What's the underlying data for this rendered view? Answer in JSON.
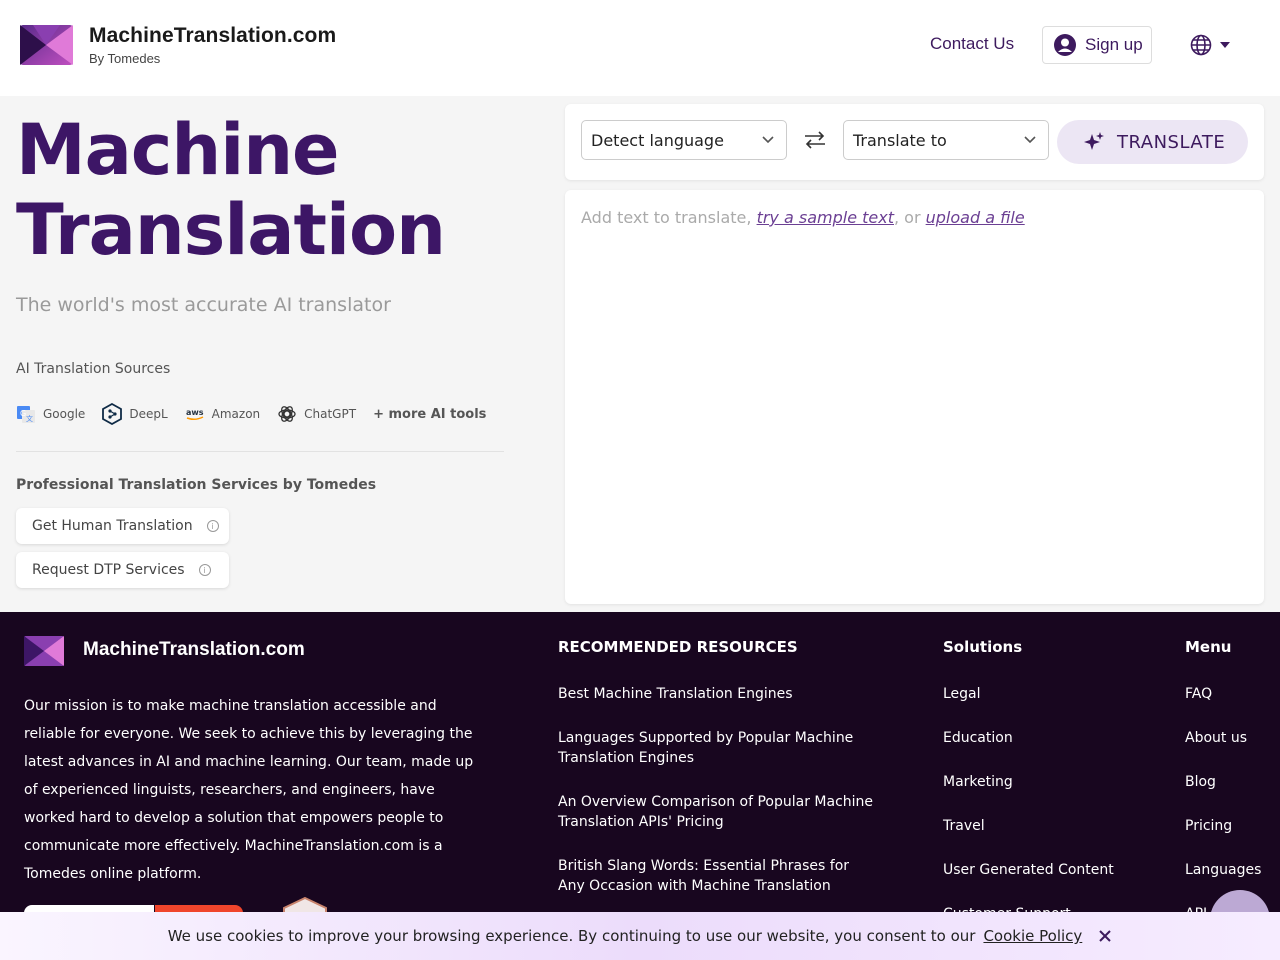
{
  "header": {
    "brand_name": "MachineTranslation.com",
    "brand_sub": "By Tomedes",
    "contact": "Contact Us",
    "signup": "Sign up"
  },
  "hero": {
    "title_line1": "Machine",
    "title_line2": "Translation",
    "subtitle": "The world's most accurate AI translator",
    "sources_label": "AI Translation Sources",
    "sources": [
      {
        "label": "Google",
        "icon": "google-translate-icon"
      },
      {
        "label": "DeepL",
        "icon": "deepl-icon"
      },
      {
        "label": "Amazon",
        "icon": "aws-icon"
      },
      {
        "label": "ChatGPT",
        "icon": "chatgpt-icon"
      }
    ],
    "more_tools": "+ more AI tools",
    "pro_title": "Professional Translation Services by Tomedes",
    "pro_buttons": [
      "Get Human Translation",
      "Request DTP Services"
    ]
  },
  "translator": {
    "source_lang": "Detect language",
    "target_lang": "Translate to",
    "translate_label": "TRANSLATE",
    "placeholder_prefix": "Add text to translate,",
    "sample_link": "try a sample text",
    "or_text": ", or",
    "upload_link": "upload a file"
  },
  "footer": {
    "brand_name": "MachineTranslation.com",
    "mission": "Our mission is to make machine translation accessible and reliable for everyone. We seek to achieve this by leveraging the latest advances in AI and machine learning. Our team, made up of experienced linguists, researchers, and engineers, have worked hard to develop a solution that empowers people to communicate more effectively. MachineTranslation.com is a Tomedes online platform.",
    "resources_title": "RECOMMENDED RESOURCES",
    "resources": [
      "Best Machine Translation Engines",
      "Languages Supported by Popular Machine Translation Engines",
      "An Overview Comparison of Popular Machine Translation APIs' Pricing",
      "British Slang Words: Essential Phrases for Any Occasion with Machine Translation"
    ],
    "solutions_title": "Solutions",
    "solutions": [
      "Legal",
      "Education",
      "Marketing",
      "Travel",
      "User Generated Content",
      "Customer Support"
    ],
    "menu_title": "Menu",
    "menu": [
      "FAQ",
      "About us",
      "Blog",
      "Pricing",
      "Languages",
      "API"
    ]
  },
  "cookie": {
    "text": "We use cookies to improve your browsing experience. By continuing to use our website, you consent to our",
    "policy": "Cookie Policy"
  },
  "colors": {
    "brand_purple": "#3d1666",
    "footer_bg": "#18061f",
    "translate_btn_bg": "#ece6f4"
  }
}
